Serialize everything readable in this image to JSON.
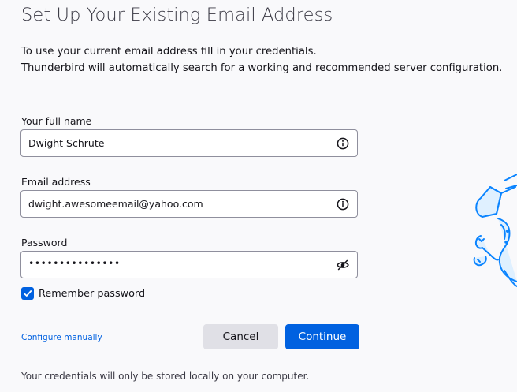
{
  "page": {
    "title": "Set Up Your Existing Email Address",
    "intro_line_1": "To use your current email address fill in your credentials.",
    "intro_line_2": "Thunderbird will automatically search for a working and recommended server configuration."
  },
  "form": {
    "full_name": {
      "label": "Your full name",
      "value": "Dwight Schrute",
      "icon": "info-icon"
    },
    "email": {
      "label": "Email address",
      "value": "dwight.awesomeemail@yahoo.com",
      "icon": "info-icon"
    },
    "password": {
      "label": "Password",
      "masked_value": "•••••••••••••••",
      "icon": "eye-slash-icon"
    },
    "remember_password": {
      "label": "Remember password",
      "checked": true
    }
  },
  "actions": {
    "configure_manually": "Configure manually",
    "cancel": "Cancel",
    "continue": "Continue"
  },
  "footer": {
    "note": "Your credentials will only be stored locally on your computer."
  },
  "colors": {
    "accent": "#0061e0",
    "background": "#f9f9fb",
    "field_border": "#8f8f9d",
    "secondary_button": "#e0e0e6",
    "illustration_stroke": "#0a84ff"
  },
  "illustration": {
    "icon": "mascot-illustration"
  }
}
